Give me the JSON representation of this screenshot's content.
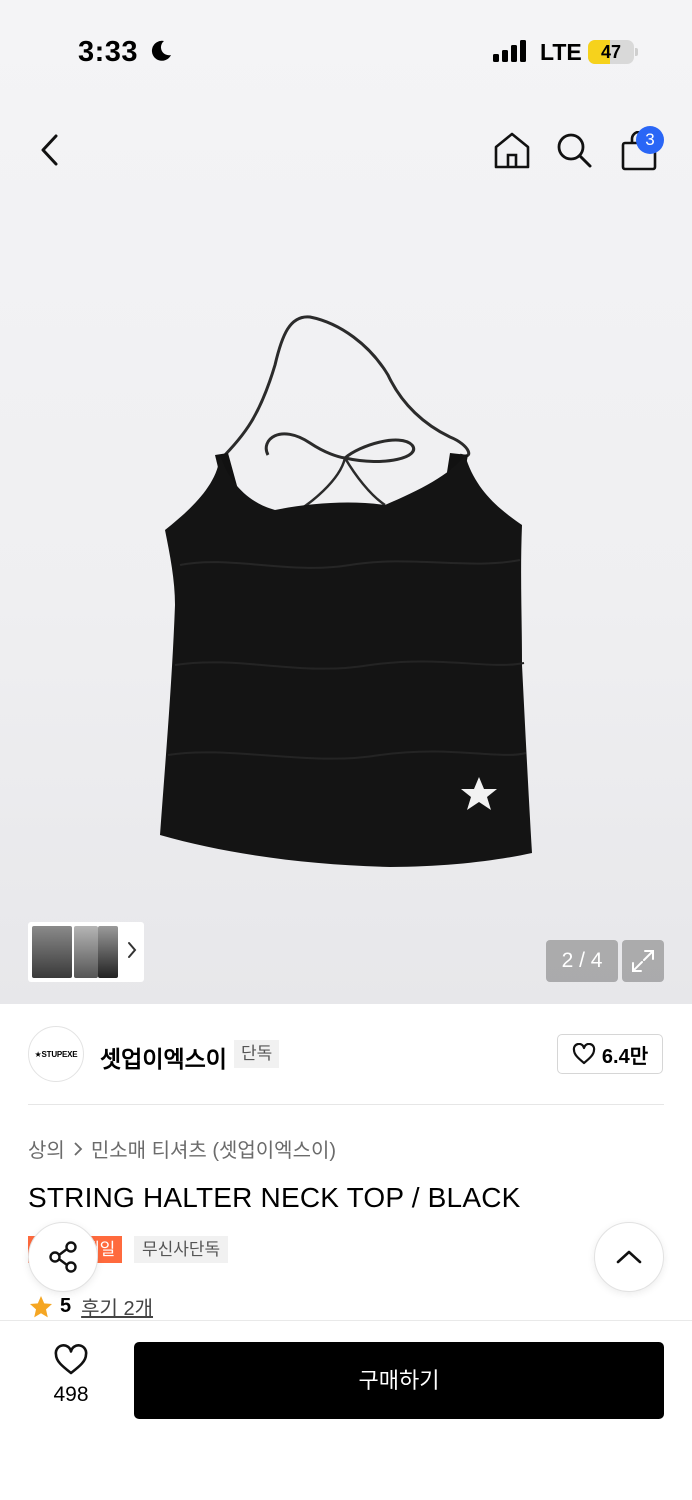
{
  "status_bar": {
    "time": "3:33",
    "network": "LTE",
    "battery": "47",
    "battery_level": 0.47
  },
  "header": {
    "cart_count": "3"
  },
  "gallery": {
    "counter": "2 / 4"
  },
  "brand": {
    "logo_text": "★STUPEXE",
    "name": "셋업이엑스이",
    "tag": "단독",
    "likes": "6.4만"
  },
  "breadcrumb": {
    "category": "상의",
    "subcategory": "민소매 티셔츠 (셋업이엑스이)"
  },
  "product": {
    "title": "STRING HALTER NECK TOP / BLACK",
    "tags": {
      "sale": "세일",
      "exclusive": "무신사단독"
    },
    "rating": "5",
    "reviews": "후기 2개"
  },
  "bottom": {
    "wish_count": "498",
    "buy_label": "구매하기"
  },
  "colors": {
    "accent_blue": "#2a66f6",
    "sale_orange": "#ff6a3d",
    "star": "#f5a623"
  }
}
